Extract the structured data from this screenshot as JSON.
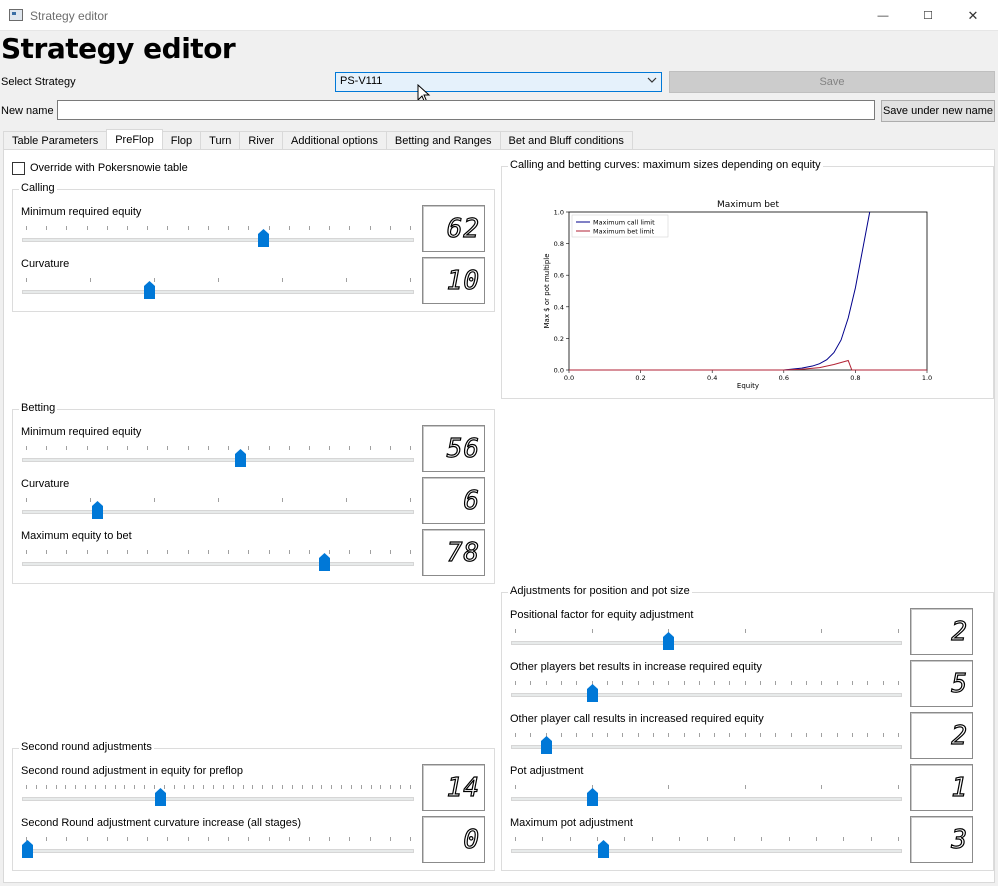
{
  "window": {
    "title": "Strategy editor",
    "minimize": "—",
    "maximize": "☐",
    "close": "✕"
  },
  "header": {
    "title": "Strategy editor"
  },
  "strategy": {
    "select_label": "Select Strategy",
    "selected": "PS-V111",
    "save_label": "Save"
  },
  "newname": {
    "label": "New name",
    "value": "",
    "save_under_label": "Save under new name"
  },
  "tabs": [
    "Table Parameters",
    "PreFlop",
    "Flop",
    "Turn",
    "River",
    "Additional options",
    "Betting and Ranges",
    "Bet and Bluff conditions"
  ],
  "active_tab": "PreFlop",
  "override": {
    "label": "Override with Pokersnowie table",
    "checked": false
  },
  "calling": {
    "title": "Calling",
    "min_equity": {
      "label": "Minimum required equity",
      "value": "62",
      "fraction": 0.62
    },
    "curvature": {
      "label": "Curvature",
      "value": "10",
      "fraction": 0.32
    }
  },
  "betting": {
    "title": "Betting",
    "min_equity": {
      "label": "Minimum required equity",
      "value": "56",
      "fraction": 0.56
    },
    "curvature": {
      "label": "Curvature",
      "value": "6",
      "fraction": 0.185
    },
    "max_equity": {
      "label": "Maximum equity to bet",
      "value": "78",
      "fraction": 0.78
    }
  },
  "second_round": {
    "title": "Second round adjustments",
    "equity": {
      "label": "Second round adjustment in equity for preflop",
      "value": "14",
      "fraction": 0.35
    },
    "curvature": {
      "label": "Second Round adjustment curvature increase (all stages)",
      "value": "0",
      "fraction": 0.0
    }
  },
  "curves": {
    "title": "Calling and betting curves: maximum sizes depending on equity"
  },
  "adjustments": {
    "title": "Adjustments for position and pot size",
    "positional": {
      "label": "Positional factor for equity adjustment",
      "value": "2",
      "fraction": 0.4
    },
    "bet_increase": {
      "label": "Other players bet results in increase required equity",
      "value": "5",
      "fraction": 0.2
    },
    "call_increase": {
      "label": "Other player call results in increased required equity",
      "value": "2",
      "fraction": 0.08
    },
    "pot": {
      "label": "Pot adjustment",
      "value": "1",
      "fraction": 0.2
    },
    "max_pot": {
      "label": "Maximum pot adjustment",
      "value": "3",
      "fraction": 0.23
    }
  },
  "chart_data": {
    "type": "line",
    "title": "Maximum bet",
    "xlabel": "Equity",
    "ylabel": "Max $ or pot multiple",
    "xlim": [
      0.0,
      1.0
    ],
    "ylim": [
      0.0,
      1.0
    ],
    "x_ticks": [
      "0.0",
      "0.2",
      "0.4",
      "0.6",
      "0.8",
      "1.0"
    ],
    "y_ticks": [
      "0.0",
      "0.2",
      "0.4",
      "0.6",
      "0.8",
      "1.0"
    ],
    "legend_position": "top-left",
    "series": [
      {
        "name": "Maximum call limit",
        "color": "#00008b",
        "x": [
          0.0,
          0.6,
          0.62,
          0.65,
          0.68,
          0.7,
          0.72,
          0.74,
          0.76,
          0.78,
          0.8,
          0.82,
          0.84
        ],
        "y": [
          0.0,
          0.0,
          0.005,
          0.012,
          0.025,
          0.04,
          0.065,
          0.11,
          0.19,
          0.33,
          0.52,
          0.76,
          1.0
        ]
      },
      {
        "name": "Maximum bet limit",
        "color": "#b22234",
        "x": [
          0.0,
          0.6,
          0.65,
          0.7,
          0.74,
          0.78,
          0.79,
          1.0
        ],
        "y": [
          0.0,
          0.0,
          0.005,
          0.015,
          0.035,
          0.06,
          0.0,
          0.0
        ]
      }
    ]
  }
}
